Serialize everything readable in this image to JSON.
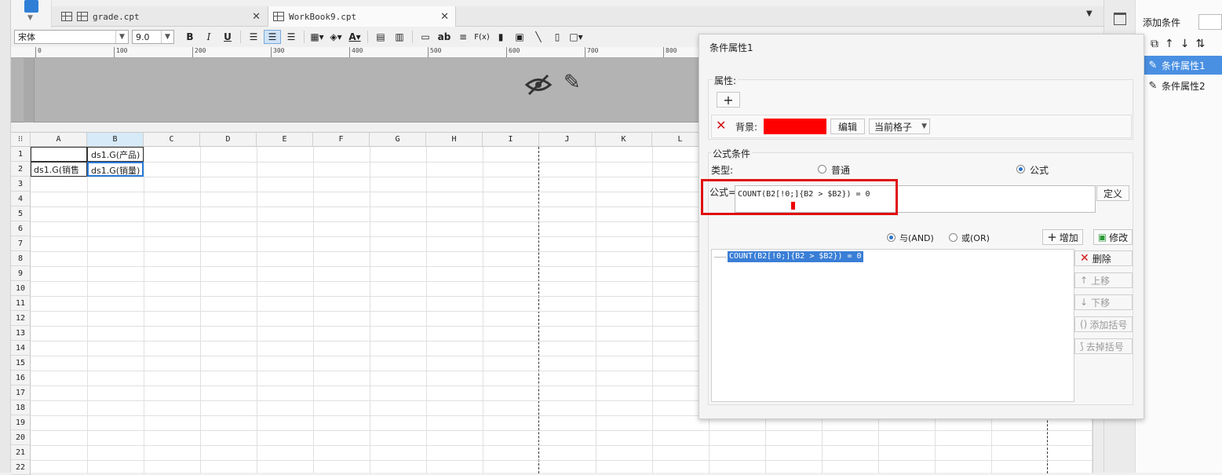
{
  "tabs": [
    {
      "label": "grade.cpt"
    },
    {
      "label": "WorkBook9.cpt"
    }
  ],
  "toolbar": {
    "font_name": "宋体",
    "font_size": "9.0",
    "bold": "B",
    "italic": "I",
    "underline": "U",
    "text_label": "ab",
    "fx_label": "F(x)"
  },
  "ruler_ticks": [
    "0",
    "100",
    "200",
    "300",
    "400",
    "500",
    "600",
    "700",
    "800"
  ],
  "columns": [
    "A",
    "B",
    "C",
    "D",
    "E",
    "F",
    "G",
    "H",
    "I",
    "J",
    "K",
    "L"
  ],
  "rows": [
    "1",
    "2",
    "3",
    "4",
    "5",
    "6",
    "7",
    "8",
    "9",
    "10",
    "11",
    "12",
    "13",
    "14",
    "15",
    "16",
    "17",
    "18",
    "19",
    "20",
    "21",
    "22"
  ],
  "cells": {
    "b1": "ds1.G(产品)",
    "a2": "ds1.G(销售",
    "b2": "ds1.G(销量)"
  },
  "dialog": {
    "title": "条件属性1",
    "attr_section": "属性:",
    "add_btn": "+",
    "bg_label": "背景:",
    "bg_color": "#ff0000",
    "edit_btn": "编辑",
    "scope_select": "当前格子",
    "formula_section": "公式条件",
    "type_label": "类型:",
    "type_normal": "普通",
    "type_formula": "公式",
    "formula_label": "公式=",
    "formula_value": "COUNT(B2[!0;]{B2 > $B2}) = 0",
    "define_btn": "定义",
    "and_label": "与(AND)",
    "or_label": "或(OR)",
    "add_label": "增加",
    "modify_label": "修改",
    "list_items": [
      "COUNT(B2[!0;]{B2 > $B2}) = 0"
    ],
    "delete_btn": "删除",
    "move_up_btn": "上移",
    "move_down_btn": "下移",
    "add_paren_btn": "添加括号",
    "remove_paren_btn": "去掉括号"
  },
  "conditions_panel": {
    "title": "添加条件",
    "items": [
      "条件属性1",
      "条件属性2"
    ]
  },
  "colors": {
    "accent": "#4a90e2",
    "highlight_frame": "#e01010"
  }
}
